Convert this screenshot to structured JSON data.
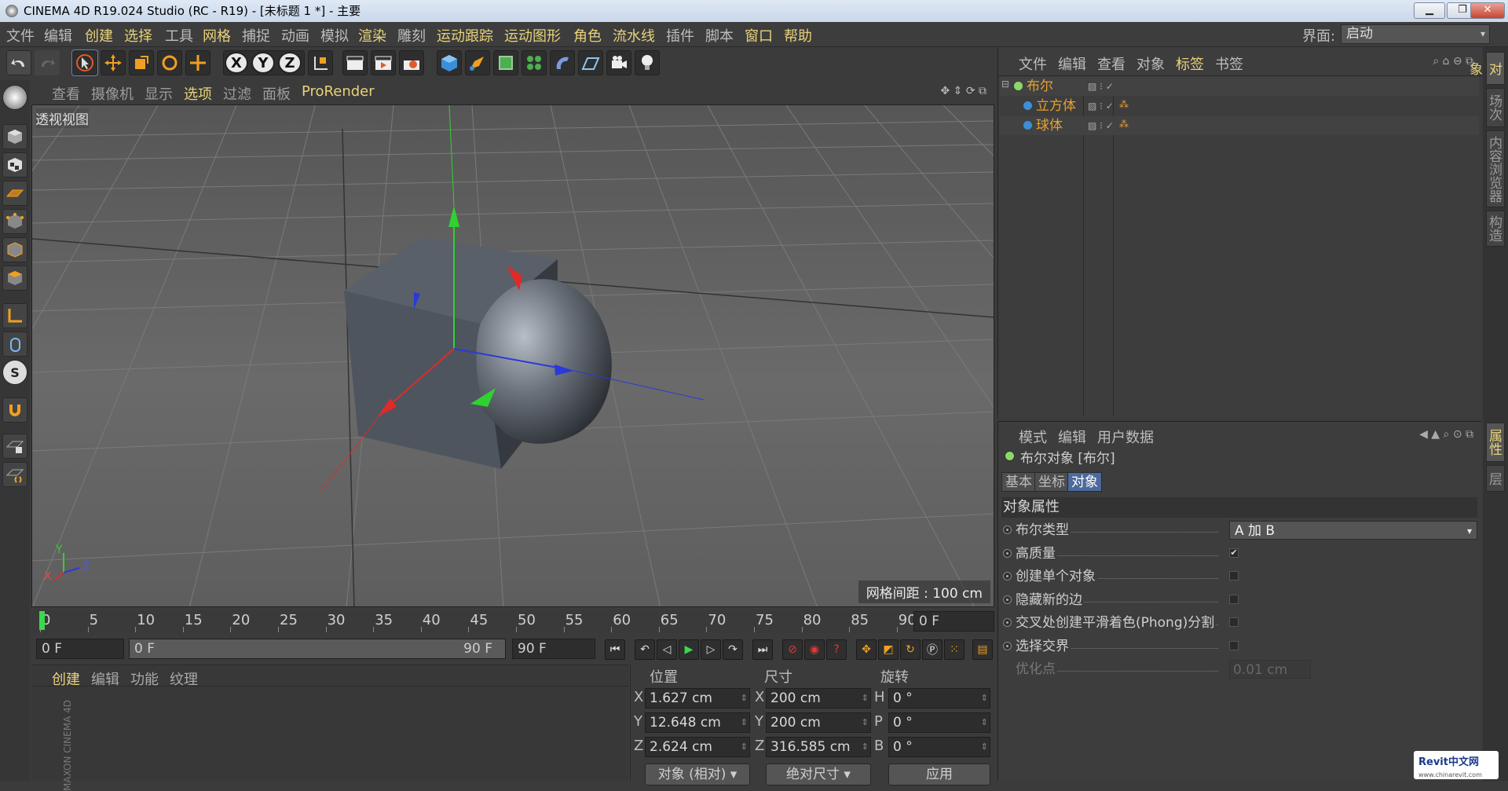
{
  "window": {
    "title": "CINEMA 4D R19.024 Studio (RC - R19) - [未标题 1 *] - 主要"
  },
  "menu": {
    "items": [
      {
        "label": "文件",
        "hl": false
      },
      {
        "label": "编辑",
        "hl": false
      },
      {
        "label": "创建",
        "hl": true
      },
      {
        "label": "选择",
        "hl": true
      },
      {
        "label": "工具",
        "hl": false
      },
      {
        "label": "网格",
        "hl": true
      },
      {
        "label": "捕捉",
        "hl": false
      },
      {
        "label": "动画",
        "hl": false
      },
      {
        "label": "模拟",
        "hl": false
      },
      {
        "label": "渲染",
        "hl": true
      },
      {
        "label": "雕刻",
        "hl": false
      },
      {
        "label": "运动跟踪",
        "hl": true
      },
      {
        "label": "运动图形",
        "hl": true
      },
      {
        "label": "角色",
        "hl": true
      },
      {
        "label": "流水线",
        "hl": true
      },
      {
        "label": "插件",
        "hl": false
      },
      {
        "label": "脚本",
        "hl": false
      },
      {
        "label": "窗口",
        "hl": true
      },
      {
        "label": "帮助",
        "hl": true
      }
    ],
    "interface_label": "界面:",
    "interface_value": "启动"
  },
  "toolbar": {
    "axis_x": "X",
    "axis_y": "Y",
    "axis_z": "Z"
  },
  "viewport": {
    "menu": [
      {
        "label": "查看",
        "hl": false
      },
      {
        "label": "摄像机",
        "hl": false
      },
      {
        "label": "显示",
        "hl": false
      },
      {
        "label": "选项",
        "hl": true
      },
      {
        "label": "过滤",
        "hl": false
      },
      {
        "label": "面板",
        "hl": false
      },
      {
        "label": "ProRender",
        "hl": true
      }
    ],
    "view_name": "透视视图",
    "grid_spacing": "网格间距 : 100 cm",
    "axis_labels": {
      "x": "X",
      "y": "Y",
      "z": "Z"
    }
  },
  "timeline": {
    "ticks": [
      "0",
      "5",
      "10",
      "15",
      "20",
      "25",
      "30",
      "35",
      "40",
      "45",
      "50",
      "55",
      "60",
      "65",
      "70",
      "75",
      "80",
      "85",
      "90"
    ],
    "current_frame": "0 F"
  },
  "transport": {
    "start": "0 F",
    "range_start": "0 F",
    "range_end": "90 F",
    "end": "90 F"
  },
  "materials": {
    "menu": [
      {
        "label": "创建",
        "hl": true
      },
      {
        "label": "编辑",
        "hl": false
      },
      {
        "label": "功能",
        "hl": false
      },
      {
        "label": "纹理",
        "hl": false
      }
    ],
    "brand": "MAXON CINEMA 4D"
  },
  "coords": {
    "headers": {
      "position": "位置",
      "size": "尺寸",
      "rotation": "旋转"
    },
    "rows": [
      {
        "axis": "X",
        "pos": "1.627 cm",
        "saxis": "X",
        "size": "200 cm",
        "raxis": "H",
        "rot": "0 °"
      },
      {
        "axis": "Y",
        "pos": "12.648 cm",
        "saxis": "Y",
        "size": "200 cm",
        "raxis": "P",
        "rot": "0 °"
      },
      {
        "axis": "Z",
        "pos": "2.624 cm",
        "saxis": "Z",
        "size": "316.585 cm",
        "raxis": "B",
        "rot": "0 °"
      }
    ],
    "mode": "对象 (相对)",
    "size_mode": "绝对尺寸",
    "apply": "应用"
  },
  "object_manager": {
    "menu": [
      {
        "label": "文件",
        "hl": false
      },
      {
        "label": "编辑",
        "hl": false
      },
      {
        "label": "查看",
        "hl": false
      },
      {
        "label": "对象",
        "hl": false
      },
      {
        "label": "标签",
        "hl": true
      },
      {
        "label": "书签",
        "hl": false
      }
    ],
    "objects": [
      {
        "name": "布尔",
        "indent": 0
      },
      {
        "name": "立方体",
        "indent": 1
      },
      {
        "name": "球体",
        "indent": 1
      }
    ]
  },
  "attributes": {
    "menu": [
      {
        "label": "模式"
      },
      {
        "label": "编辑"
      },
      {
        "label": "用户数据"
      }
    ],
    "object_title": "布尔对象 [布尔]",
    "tabs": [
      {
        "label": "基本",
        "active": false
      },
      {
        "label": "坐标",
        "active": false
      },
      {
        "label": "对象",
        "active": true
      }
    ],
    "section": "对象属性",
    "props": [
      {
        "label": "布尔类型",
        "type": "dropdown",
        "value": "A 加 B"
      },
      {
        "label": "高质量",
        "type": "check",
        "value": "✔"
      },
      {
        "label": "创建单个对象",
        "type": "check",
        "value": ""
      },
      {
        "label": "隐藏新的边",
        "type": "check",
        "value": ""
      },
      {
        "label": "交叉处创建平滑着色(Phong)分割",
        "type": "check",
        "value": ""
      },
      {
        "label": "选择交界",
        "type": "check",
        "value": ""
      },
      {
        "label": "优化点",
        "type": "number",
        "value": "0.01 cm"
      }
    ]
  },
  "right_tabs": {
    "top": [
      {
        "label": "对象",
        "active": true
      },
      {
        "label": "场次",
        "active": false
      },
      {
        "label": "内容浏览器",
        "active": false
      },
      {
        "label": "构造",
        "active": false
      }
    ],
    "bottom": [
      {
        "label": "属性",
        "active": true
      },
      {
        "label": "层",
        "active": false
      }
    ]
  },
  "watermark": {
    "text": "Revit中文网",
    "sub": "www.chinarevit.com"
  }
}
